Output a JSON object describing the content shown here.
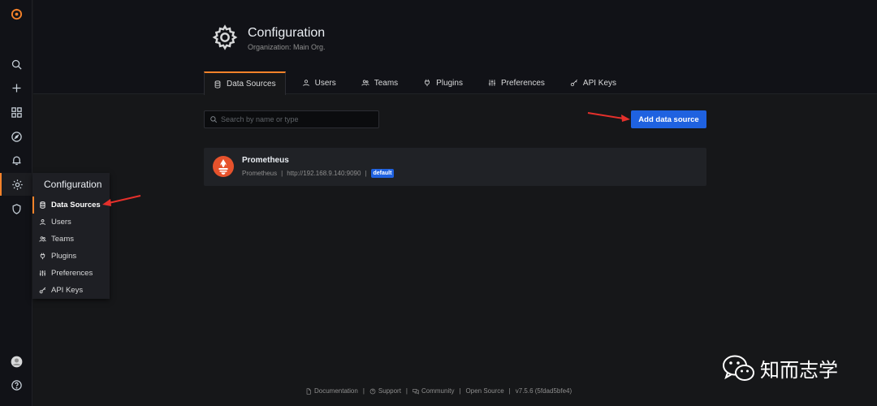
{
  "sidebar": {
    "items": [
      {
        "icon": "grafana-logo-icon"
      },
      {
        "icon": "search-icon"
      },
      {
        "icon": "plus-icon"
      },
      {
        "icon": "dashboards-icon"
      },
      {
        "icon": "explore-compass-icon"
      },
      {
        "icon": "alert-bell-icon"
      },
      {
        "icon": "gear-icon"
      },
      {
        "icon": "shield-icon"
      },
      {
        "icon": "user-avatar-icon"
      },
      {
        "icon": "help-icon"
      }
    ]
  },
  "flyout": {
    "title": "Configuration",
    "items": [
      {
        "label": "Data Sources",
        "icon": "database-icon"
      },
      {
        "label": "Users",
        "icon": "user-icon"
      },
      {
        "label": "Teams",
        "icon": "users-icon"
      },
      {
        "label": "Plugins",
        "icon": "plug-icon"
      },
      {
        "label": "Preferences",
        "icon": "sliders-icon"
      },
      {
        "label": "API Keys",
        "icon": "key-icon"
      }
    ]
  },
  "header": {
    "title": "Configuration",
    "subtitle": "Organization: Main Org."
  },
  "tabs": [
    {
      "label": "Data Sources",
      "icon": "database-icon",
      "active": true
    },
    {
      "label": "Users",
      "icon": "user-icon"
    },
    {
      "label": "Teams",
      "icon": "users-icon"
    },
    {
      "label": "Plugins",
      "icon": "plug-icon"
    },
    {
      "label": "Preferences",
      "icon": "sliders-icon"
    },
    {
      "label": "API Keys",
      "icon": "key-icon"
    }
  ],
  "search": {
    "placeholder": "Search by name or type",
    "value": ""
  },
  "actions": {
    "add_label": "Add data source"
  },
  "datasources": [
    {
      "name": "Prometheus",
      "type": "Prometheus",
      "url": "http://192.168.9.140:9090",
      "badge": "default"
    }
  ],
  "footer": {
    "documentation": "Documentation",
    "support": "Support",
    "community": "Community",
    "open_source": "Open Source",
    "version": "v7.5.6 (5fdad5bfe4)",
    "sep": "|"
  },
  "watermark": {
    "text": "知而志学"
  },
  "colors": {
    "accent": "#f5822a",
    "primary": "#1f62e0",
    "background": "#161719",
    "prometheus": "#e6522c"
  }
}
